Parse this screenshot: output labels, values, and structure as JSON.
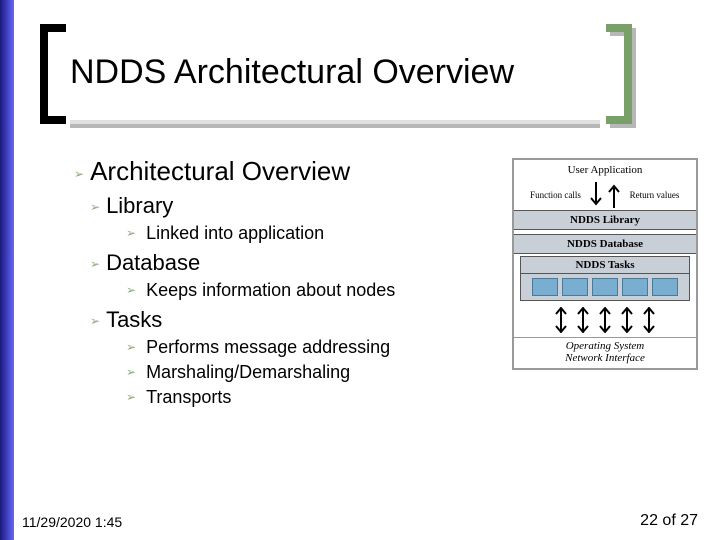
{
  "title": "NDDS Architectural Overview",
  "content": {
    "h1": "Architectural Overview",
    "library": {
      "label": "Library",
      "items": [
        "Linked into application"
      ]
    },
    "database": {
      "label": "Database",
      "items": [
        "Keeps information about nodes"
      ]
    },
    "tasks": {
      "label": "Tasks",
      "items": [
        "Performs message addressing",
        "Marshaling/Demarshaling",
        "Transports"
      ]
    }
  },
  "diagram": {
    "user_app": "User Application",
    "func_calls": "Function calls",
    "return_values": "Return values",
    "lib": "NDDS Library",
    "db": "NDDS Database",
    "tasks": "NDDS Tasks",
    "os": "Operating System\nNetwork Interface"
  },
  "footer": {
    "timestamp": "11/29/2020 1:45",
    "page": "22 of 27"
  }
}
